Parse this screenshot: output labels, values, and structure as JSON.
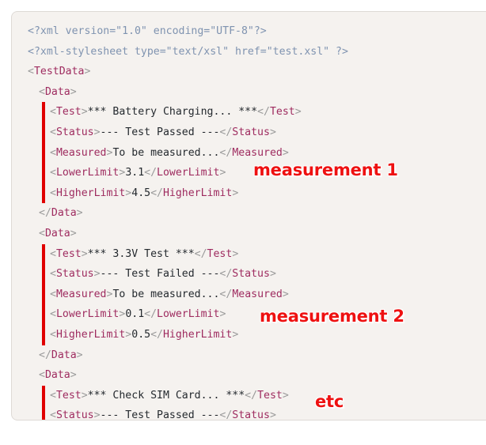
{
  "document": {
    "title": "XML test data listing",
    "language": "xml",
    "background_color": "#ffffff",
    "panel_color": "#f5f2ef",
    "panel_border_color": "#dedad6"
  },
  "colors": {
    "processing_instruction": "#7f93b0",
    "bracket": "#9a9a9a",
    "tag_name": "#9e2b5f",
    "text_content": "#24292e",
    "marker_bar": "#e00000",
    "annotation": "#ee1111"
  },
  "code": {
    "lines": [
      {
        "indent": 0,
        "barred": false,
        "tokens": [
          {
            "type": "pi",
            "text": "<?xml version=\"1.0\" encoding=\"UTF-8\"?>"
          }
        ]
      },
      {
        "indent": 0,
        "barred": false,
        "tokens": [
          {
            "type": "pi",
            "text": "<?xml-stylesheet type=\"text/xsl\" href=\"test.xsl\" ?>"
          }
        ]
      },
      {
        "indent": 0,
        "barred": false,
        "tokens": [
          {
            "type": "bracket",
            "text": "<"
          },
          {
            "type": "tag",
            "text": "TestData"
          },
          {
            "type": "bracket",
            "text": ">"
          }
        ]
      },
      {
        "indent": 1,
        "barred": false,
        "tokens": [
          {
            "type": "bracket",
            "text": "<"
          },
          {
            "type": "tag",
            "text": "Data"
          },
          {
            "type": "bracket",
            "text": ">"
          }
        ]
      },
      {
        "indent": 2,
        "barred": true,
        "tokens": [
          {
            "type": "bracket",
            "text": "<"
          },
          {
            "type": "tag",
            "text": "Test"
          },
          {
            "type": "bracket",
            "text": ">"
          },
          {
            "type": "text",
            "text": "*** Battery Charging... ***"
          },
          {
            "type": "bracket",
            "text": "</"
          },
          {
            "type": "tag",
            "text": "Test"
          },
          {
            "type": "bracket",
            "text": ">"
          }
        ]
      },
      {
        "indent": 2,
        "barred": true,
        "tokens": [
          {
            "type": "bracket",
            "text": "<"
          },
          {
            "type": "tag",
            "text": "Status"
          },
          {
            "type": "bracket",
            "text": ">"
          },
          {
            "type": "text",
            "text": "--- Test Passed ---"
          },
          {
            "type": "bracket",
            "text": "</"
          },
          {
            "type": "tag",
            "text": "Status"
          },
          {
            "type": "bracket",
            "text": ">"
          }
        ]
      },
      {
        "indent": 2,
        "barred": true,
        "tokens": [
          {
            "type": "bracket",
            "text": "<"
          },
          {
            "type": "tag",
            "text": "Measured"
          },
          {
            "type": "bracket",
            "text": ">"
          },
          {
            "type": "text",
            "text": "To be measured..."
          },
          {
            "type": "bracket",
            "text": "</"
          },
          {
            "type": "tag",
            "text": "Measured"
          },
          {
            "type": "bracket",
            "text": ">"
          }
        ]
      },
      {
        "indent": 2,
        "barred": true,
        "tokens": [
          {
            "type": "bracket",
            "text": "<"
          },
          {
            "type": "tag",
            "text": "LowerLimit"
          },
          {
            "type": "bracket",
            "text": ">"
          },
          {
            "type": "text",
            "text": "3.1"
          },
          {
            "type": "bracket",
            "text": "</"
          },
          {
            "type": "tag",
            "text": "LowerLimit"
          },
          {
            "type": "bracket",
            "text": ">"
          }
        ]
      },
      {
        "indent": 2,
        "barred": true,
        "tokens": [
          {
            "type": "bracket",
            "text": "<"
          },
          {
            "type": "tag",
            "text": "HigherLimit"
          },
          {
            "type": "bracket",
            "text": ">"
          },
          {
            "type": "text",
            "text": "4.5"
          },
          {
            "type": "bracket",
            "text": "</"
          },
          {
            "type": "tag",
            "text": "HigherLimit"
          },
          {
            "type": "bracket",
            "text": ">"
          }
        ]
      },
      {
        "indent": 1,
        "barred": false,
        "tokens": [
          {
            "type": "bracket",
            "text": "</"
          },
          {
            "type": "tag",
            "text": "Data"
          },
          {
            "type": "bracket",
            "text": ">"
          }
        ]
      },
      {
        "indent": 1,
        "barred": false,
        "tokens": [
          {
            "type": "bracket",
            "text": "<"
          },
          {
            "type": "tag",
            "text": "Data"
          },
          {
            "type": "bracket",
            "text": ">"
          }
        ]
      },
      {
        "indent": 2,
        "barred": true,
        "tokens": [
          {
            "type": "bracket",
            "text": "<"
          },
          {
            "type": "tag",
            "text": "Test"
          },
          {
            "type": "bracket",
            "text": ">"
          },
          {
            "type": "text",
            "text": "*** 3.3V Test ***"
          },
          {
            "type": "bracket",
            "text": "</"
          },
          {
            "type": "tag",
            "text": "Test"
          },
          {
            "type": "bracket",
            "text": ">"
          }
        ]
      },
      {
        "indent": 2,
        "barred": true,
        "tokens": [
          {
            "type": "bracket",
            "text": "<"
          },
          {
            "type": "tag",
            "text": "Status"
          },
          {
            "type": "bracket",
            "text": ">"
          },
          {
            "type": "text",
            "text": "--- Test Failed ---"
          },
          {
            "type": "bracket",
            "text": "</"
          },
          {
            "type": "tag",
            "text": "Status"
          },
          {
            "type": "bracket",
            "text": ">"
          }
        ]
      },
      {
        "indent": 2,
        "barred": true,
        "tokens": [
          {
            "type": "bracket",
            "text": "<"
          },
          {
            "type": "tag",
            "text": "Measured"
          },
          {
            "type": "bracket",
            "text": ">"
          },
          {
            "type": "text",
            "text": "To be measured..."
          },
          {
            "type": "bracket",
            "text": "</"
          },
          {
            "type": "tag",
            "text": "Measured"
          },
          {
            "type": "bracket",
            "text": ">"
          }
        ]
      },
      {
        "indent": 2,
        "barred": true,
        "tokens": [
          {
            "type": "bracket",
            "text": "<"
          },
          {
            "type": "tag",
            "text": "LowerLimit"
          },
          {
            "type": "bracket",
            "text": ">"
          },
          {
            "type": "text",
            "text": "0.1"
          },
          {
            "type": "bracket",
            "text": "</"
          },
          {
            "type": "tag",
            "text": "LowerLimit"
          },
          {
            "type": "bracket",
            "text": ">"
          }
        ]
      },
      {
        "indent": 2,
        "barred": true,
        "tokens": [
          {
            "type": "bracket",
            "text": "<"
          },
          {
            "type": "tag",
            "text": "HigherLimit"
          },
          {
            "type": "bracket",
            "text": ">"
          },
          {
            "type": "text",
            "text": "0.5"
          },
          {
            "type": "bracket",
            "text": "</"
          },
          {
            "type": "tag",
            "text": "HigherLimit"
          },
          {
            "type": "bracket",
            "text": ">"
          }
        ]
      },
      {
        "indent": 1,
        "barred": false,
        "tokens": [
          {
            "type": "bracket",
            "text": "</"
          },
          {
            "type": "tag",
            "text": "Data"
          },
          {
            "type": "bracket",
            "text": ">"
          }
        ]
      },
      {
        "indent": 1,
        "barred": false,
        "tokens": [
          {
            "type": "bracket",
            "text": "<"
          },
          {
            "type": "tag",
            "text": "Data"
          },
          {
            "type": "bracket",
            "text": ">"
          }
        ]
      },
      {
        "indent": 2,
        "barred": true,
        "tokens": [
          {
            "type": "bracket",
            "text": "<"
          },
          {
            "type": "tag",
            "text": "Test"
          },
          {
            "type": "bracket",
            "text": ">"
          },
          {
            "type": "text",
            "text": "*** Check SIM Card... ***"
          },
          {
            "type": "bracket",
            "text": "</"
          },
          {
            "type": "tag",
            "text": "Test"
          },
          {
            "type": "bracket",
            "text": ">"
          }
        ]
      },
      {
        "indent": 2,
        "barred": true,
        "tokens": [
          {
            "type": "bracket",
            "text": "<"
          },
          {
            "type": "tag",
            "text": "Status"
          },
          {
            "type": "bracket",
            "text": ">"
          },
          {
            "type": "text",
            "text": "--- Test Passed ---"
          },
          {
            "type": "bracket",
            "text": "</"
          },
          {
            "type": "tag",
            "text": "Status"
          },
          {
            "type": "bracket",
            "text": ">"
          }
        ]
      }
    ]
  },
  "annotations": [
    {
      "id": "measurement-1",
      "label": "measurement 1"
    },
    {
      "id": "measurement-2",
      "label": "measurement 2"
    },
    {
      "id": "etc",
      "label": "etc"
    }
  ]
}
